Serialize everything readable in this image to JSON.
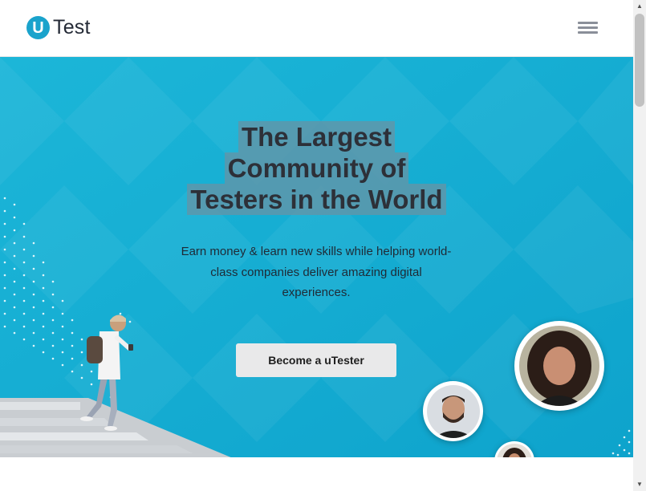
{
  "header": {
    "logo_mark": "U",
    "logo_text": "Test",
    "menu_icon": "hamburger-menu-icon"
  },
  "hero": {
    "headline_lines": [
      "The Largest",
      "Community of",
      "Testers in the World"
    ],
    "subtext": "Earn money & learn new skills while helping world-class companies deliver amazing digital experiences.",
    "cta_label": "Become a uTester"
  },
  "colors": {
    "brand_blue": "#1aa3cc",
    "hero_bg": "#17aed3",
    "headline_highlight": "#5e96aa",
    "cta_bg": "#e9e9ea"
  },
  "avatars": [
    "avatar-woman-curly-hair",
    "avatar-man-beard",
    "avatar-woman-small"
  ]
}
